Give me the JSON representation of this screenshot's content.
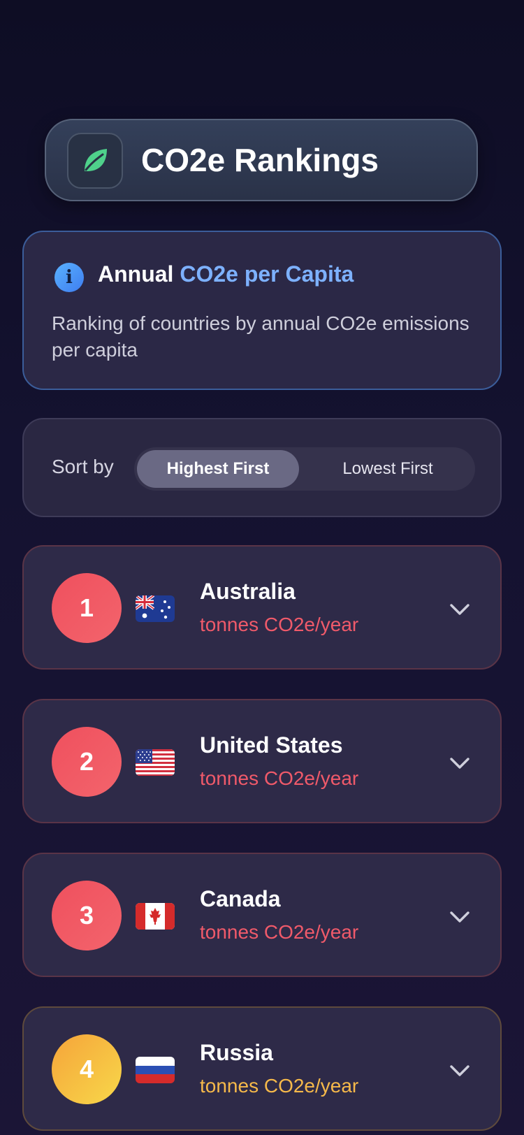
{
  "header": {
    "title": "CO2e Rankings",
    "icon": "leaf-icon",
    "accent_color": "#4fd18b"
  },
  "info": {
    "title_plain": "Annual ",
    "title_accent": "CO2e per Capita",
    "description": "Ranking of countries by annual CO2e emissions per capita",
    "icon": "info-icon",
    "accent_color": "#7db1ff"
  },
  "sort": {
    "label": "Sort by",
    "options": [
      "Highest First",
      "Lowest First"
    ],
    "selected": "Highest First"
  },
  "rankings": [
    {
      "rank": "1",
      "country": "Australia",
      "unit": "tonnes CO2e/year",
      "flag": "australia-flag-icon",
      "color": "#f05a6a"
    },
    {
      "rank": "2",
      "country": "United States",
      "unit": "tonnes CO2e/year",
      "flag": "us-flag-icon",
      "color": "#f05a6a"
    },
    {
      "rank": "3",
      "country": "Canada",
      "unit": "tonnes CO2e/year",
      "flag": "canada-flag-icon",
      "color": "#f05a6a"
    },
    {
      "rank": "4",
      "country": "Russia",
      "unit": "tonnes CO2e/year",
      "flag": "russia-flag-icon",
      "color": "#f6b94a"
    }
  ]
}
